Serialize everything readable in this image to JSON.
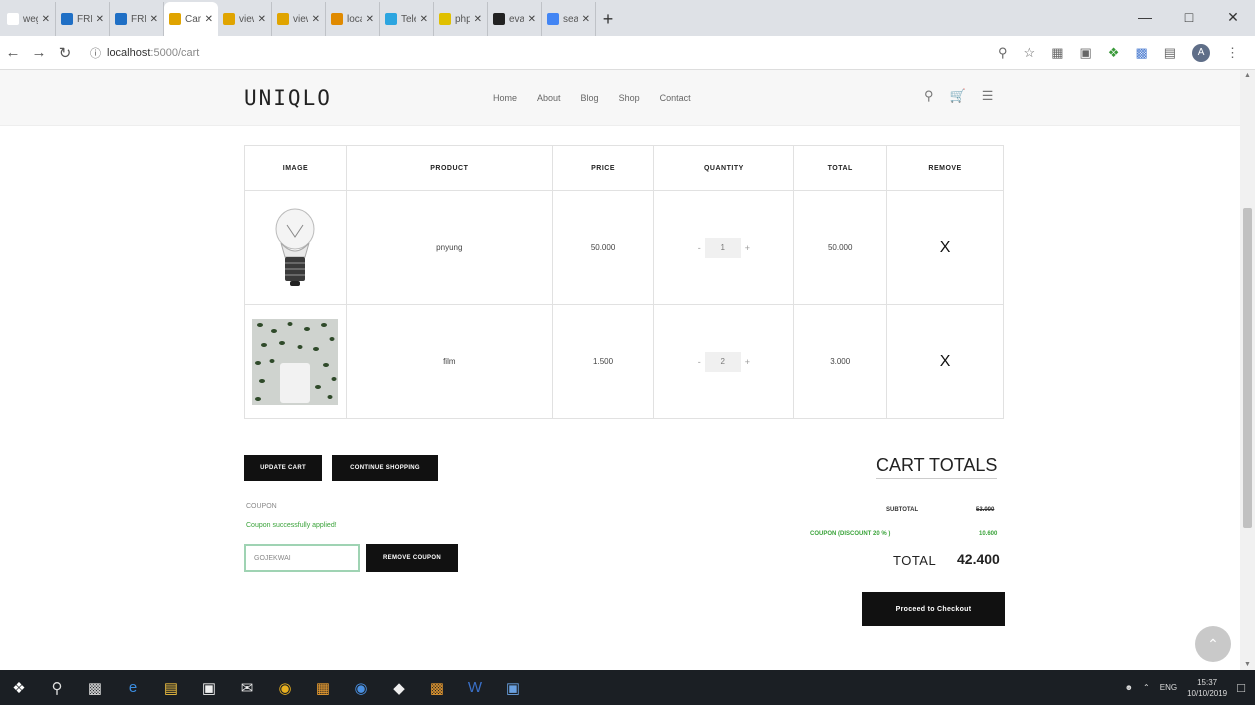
{
  "browser": {
    "tabs": [
      {
        "label": "wegan",
        "icon": "wikipedia-icon",
        "color": "#ffffff"
      },
      {
        "label": "FREE F",
        "icon": "site-blue-icon",
        "color": "#1f6fc5"
      },
      {
        "label": "FREE F",
        "icon": "site-blue-icon",
        "color": "#1f6fc5"
      },
      {
        "label": "Cart",
        "icon": "site-yellow-icon",
        "color": "#e0a400",
        "active": true
      },
      {
        "label": "view-s",
        "icon": "site-yellow-icon",
        "color": "#e0a400"
      },
      {
        "label": "view-s",
        "icon": "site-yellow-icon",
        "color": "#e0a400"
      },
      {
        "label": "localh",
        "icon": "site-orange-icon",
        "color": "#e08a00"
      },
      {
        "label": "Telegr",
        "icon": "telegram-icon",
        "color": "#2ca5e0"
      },
      {
        "label": "php",
        "icon": "site-yellow-icon",
        "color": "#e0c000"
      },
      {
        "label": "evanf",
        "icon": "github-icon",
        "color": "#222222"
      },
      {
        "label": "search",
        "icon": "google-icon",
        "color": "#4285f4"
      }
    ],
    "url": {
      "host": "localhost",
      "path": ":5000/cart"
    }
  },
  "site": {
    "logo": "UNIQLO",
    "nav": [
      "Home",
      "About",
      "Blog",
      "Shop",
      "Contact"
    ]
  },
  "cart": {
    "headers": [
      "IMAGE",
      "PRODUCT",
      "PRICE",
      "QUANTITY",
      "TOTAL",
      "REMOVE"
    ],
    "rows": [
      {
        "product": "pnyung",
        "price": "50.000",
        "quantity": "1",
        "total": "50.000",
        "remove": "X",
        "image": "light-bulb"
      },
      {
        "product": "film",
        "price": "1.500",
        "quantity": "2",
        "total": "3.000",
        "remove": "X",
        "image": "green-pattern"
      }
    ]
  },
  "actions": {
    "update_cart": "UPDATE CART",
    "continue_shopping": "CONTINUE SHOPPING",
    "coupon_label": "COUPON",
    "coupon_message": "Coupon successfully applied!",
    "coupon_code": "GOJEKWAI",
    "remove_coupon": "REMOVE COUPON",
    "checkout": "Proceed to Checkout"
  },
  "totals": {
    "title": "CART TOTALS",
    "subtotal_label": "SUBTOTAL",
    "subtotal_value": "53.000",
    "coupon_label": "COUPON (DISCOUNT 20 % )",
    "coupon_value": "10.600",
    "total_label": "TOTAL",
    "total_value": "42.400"
  },
  "system": {
    "language": "ENG",
    "time": "15:37",
    "date": "10/10/2019"
  },
  "colors": {
    "accent_green": "#3aa33a",
    "button_dark": "#111111"
  }
}
